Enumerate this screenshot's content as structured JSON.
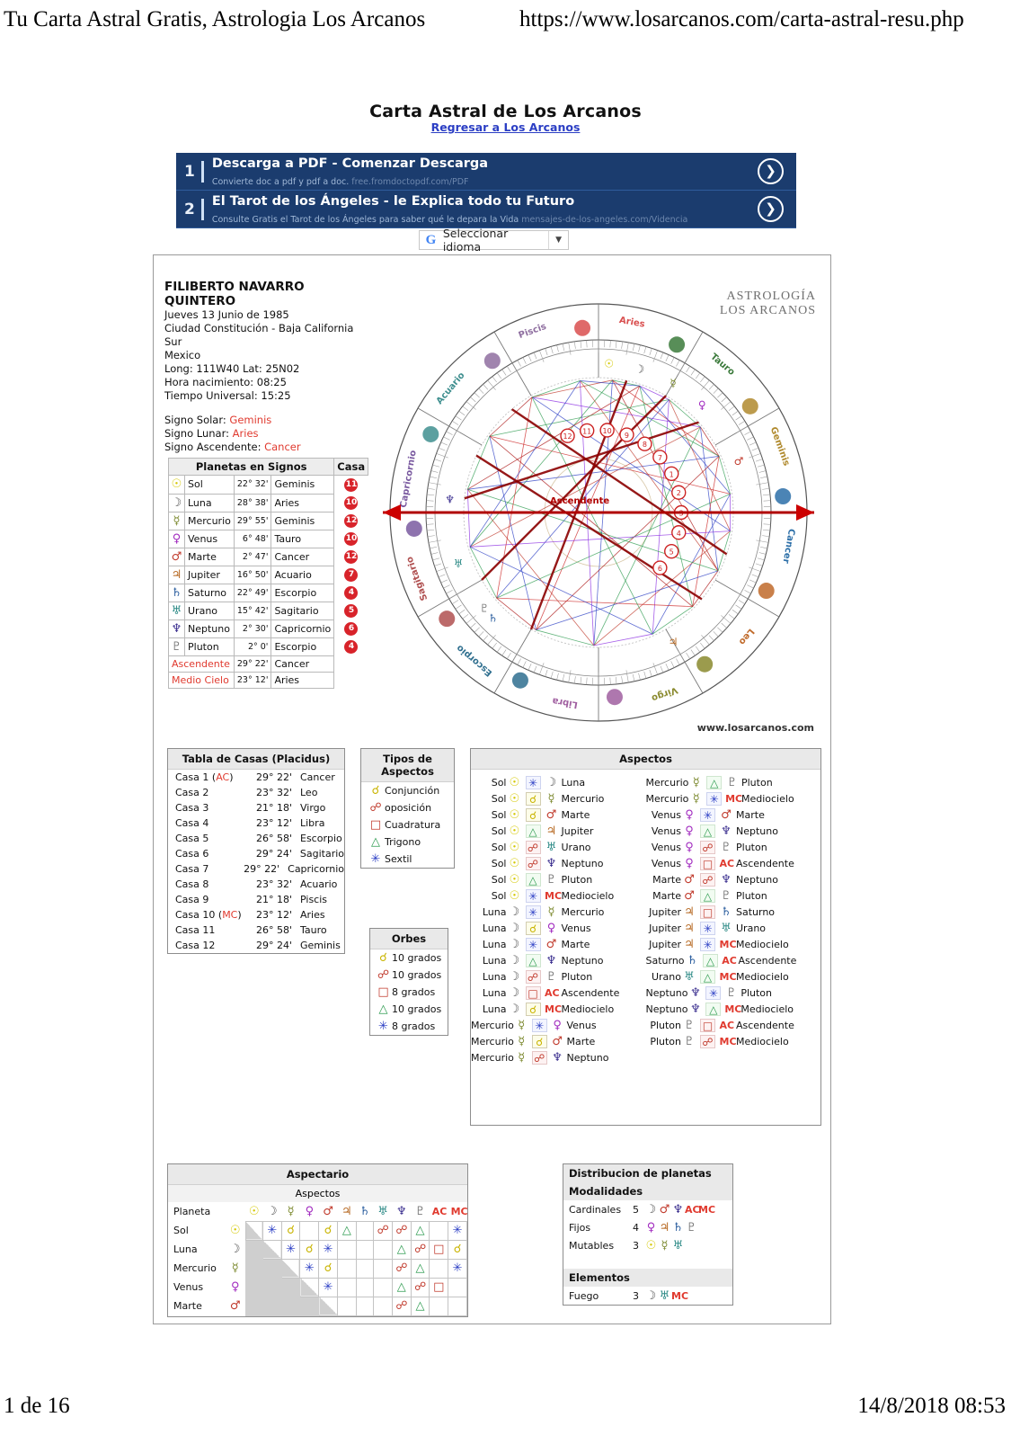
{
  "print": {
    "header_title": "Tu Carta Astral Gratis, Astrologia Los Arcanos",
    "header_url": "https://www.losarcanos.com/carta-astral-resu.php",
    "footer_page": "1 de 16",
    "footer_date": "14/8/2018 08:53"
  },
  "page": {
    "title": "Carta Astral de Los Arcanos",
    "back_link": "Regresar a Los Arcanos"
  },
  "ads": [
    {
      "num": "1",
      "headline": "Descarga a PDF - Comenzar Descarga",
      "desc": "Convierte doc a pdf y pdf a doc.",
      "url": "free.fromdoctopdf.com/PDF"
    },
    {
      "num": "2",
      "headline": "El Tarot de los Ángeles - le Explica todo tu Futuro",
      "desc": "Consulte Gratis el Tarot de los Ángeles para saber qué le depara la Vida",
      "url": "mensajes-de-los-angeles.com/Videncia"
    }
  ],
  "language": {
    "label": "Seleccionar idioma",
    "icon": "google-g-icon"
  },
  "person": {
    "name_line1": "FILIBERTO NAVARRO",
    "name_line2": "QUINTERO",
    "date": "Jueves 13 Junio de 1985",
    "city": "Ciudad Constitución - Baja California Sur",
    "country": "Mexico",
    "coords": "Long: 111W40 Lat: 25N02",
    "birth_time": "Hora nacimiento: 08:25",
    "universal_time": "Tiempo Universal: 15:25",
    "solar_label": "Signo Solar: ",
    "solar_value": "Geminis",
    "lunar_label": "Signo Lunar: ",
    "lunar_value": "Aries",
    "asc_label": "Signo Ascendente: ",
    "asc_value": "Cancer"
  },
  "planets_table": {
    "title": "Planetas en Signos",
    "house_header": "Casa",
    "rows": [
      {
        "icon": "sun-icon",
        "name": "Sol",
        "deg": "22° 32'",
        "sign": "Geminis",
        "house": "11"
      },
      {
        "icon": "moon-icon",
        "name": "Luna",
        "deg": "28° 38'",
        "sign": "Aries",
        "house": "10"
      },
      {
        "icon": "mercury-icon",
        "name": "Mercurio",
        "deg": "29° 55'",
        "sign": "Geminis",
        "house": "12"
      },
      {
        "icon": "venus-icon",
        "name": "Venus",
        "deg": "6° 48'",
        "sign": "Tauro",
        "house": "10"
      },
      {
        "icon": "mars-icon",
        "name": "Marte",
        "deg": "2° 47'",
        "sign": "Cancer",
        "house": "12"
      },
      {
        "icon": "jupiter-icon",
        "name": "Jupiter",
        "deg": "16° 50'",
        "sign": "Acuario",
        "house": "7"
      },
      {
        "icon": "saturn-icon",
        "name": "Saturno",
        "deg": "22° 49'",
        "sign": "Escorpio",
        "house": "4"
      },
      {
        "icon": "uranus-icon",
        "name": "Urano",
        "deg": "15° 42'",
        "sign": "Sagitario",
        "house": "5"
      },
      {
        "icon": "neptune-icon",
        "name": "Neptuno",
        "deg": "2° 30'",
        "sign": "Capricornio",
        "house": "6"
      },
      {
        "icon": "pluto-icon",
        "name": "Pluton",
        "deg": "2° 0'",
        "sign": "Escorpio",
        "house": "4"
      }
    ],
    "extra_rows": [
      {
        "name": "Ascendente",
        "deg": "29° 22'",
        "sign": "Cancer"
      },
      {
        "name": "Medio Cielo",
        "deg": "23° 12'",
        "sign": "Aries"
      }
    ]
  },
  "houses_table": {
    "title": "Tabla de Casas (Placidus)",
    "rows": [
      {
        "name": "Casa 1",
        "tag": "AC",
        "deg": "29° 22'",
        "sign": "Cancer"
      },
      {
        "name": "Casa 2",
        "tag": "",
        "deg": "23° 32'",
        "sign": "Leo"
      },
      {
        "name": "Casa 3",
        "tag": "",
        "deg": "21° 18'",
        "sign": "Virgo"
      },
      {
        "name": "Casa 4",
        "tag": "",
        "deg": "23° 12'",
        "sign": "Libra"
      },
      {
        "name": "Casa 5",
        "tag": "",
        "deg": "26° 58'",
        "sign": "Escorpio"
      },
      {
        "name": "Casa 6",
        "tag": "",
        "deg": "29° 24'",
        "sign": "Sagitario"
      },
      {
        "name": "Casa 7",
        "tag": "",
        "deg": "29° 22'",
        "sign": "Capricornio"
      },
      {
        "name": "Casa 8",
        "tag": "",
        "deg": "23° 32'",
        "sign": "Acuario"
      },
      {
        "name": "Casa 9",
        "tag": "",
        "deg": "21° 18'",
        "sign": "Piscis"
      },
      {
        "name": "Casa 10",
        "tag": "MC",
        "deg": "23° 12'",
        "sign": "Aries"
      },
      {
        "name": "Casa 11",
        "tag": "",
        "deg": "26° 58'",
        "sign": "Tauro"
      },
      {
        "name": "Casa 12",
        "tag": "",
        "deg": "29° 24'",
        "sign": "Geminis"
      }
    ]
  },
  "aspect_types": {
    "title_line1": "Tipos de",
    "title_line2": "Aspectos",
    "rows": [
      {
        "icon": "conjunction-icon",
        "label": "Conjunción"
      },
      {
        "icon": "opposition-icon",
        "label": "oposición"
      },
      {
        "icon": "square-icon",
        "label": "Cuadratura"
      },
      {
        "icon": "trine-icon",
        "label": "Trigono"
      },
      {
        "icon": "sextile-icon",
        "label": "Sextil"
      }
    ]
  },
  "orbs": {
    "title": "Orbes",
    "rows": [
      {
        "icon": "conjunction-icon",
        "label": "10 grados"
      },
      {
        "icon": "opposition-icon",
        "label": "10 grados"
      },
      {
        "icon": "square-icon",
        "label": "8 grados"
      },
      {
        "icon": "trine-icon",
        "label": "10 grados"
      },
      {
        "icon": "sextile-icon",
        "label": "8 grados"
      }
    ]
  },
  "aspects": {
    "title": "Aspectos",
    "left": [
      {
        "p1": "Sol",
        "i1": "sun-icon",
        "asp": "sextile-icon",
        "p2": "Luna",
        "i2": "moon-icon"
      },
      {
        "p1": "Sol",
        "i1": "sun-icon",
        "asp": "conjunction-icon",
        "p2": "Mercurio",
        "i2": "mercury-icon"
      },
      {
        "p1": "Sol",
        "i1": "sun-icon",
        "asp": "conjunction-icon",
        "p2": "Marte",
        "i2": "mars-icon"
      },
      {
        "p1": "Sol",
        "i1": "sun-icon",
        "asp": "trine-icon",
        "p2": "Jupiter",
        "i2": "jupiter-icon"
      },
      {
        "p1": "Sol",
        "i1": "sun-icon",
        "asp": "opposition-icon",
        "p2": "Urano",
        "i2": "uranus-icon"
      },
      {
        "p1": "Sol",
        "i1": "sun-icon",
        "asp": "opposition-icon",
        "p2": "Neptuno",
        "i2": "neptune-icon"
      },
      {
        "p1": "Sol",
        "i1": "sun-icon",
        "asp": "trine-icon",
        "p2": "Pluton",
        "i2": "pluto-icon"
      },
      {
        "p1": "Sol",
        "i1": "sun-icon",
        "asp": "sextile-icon",
        "p2": "Mediocielo",
        "i2": "mc-icon"
      },
      {
        "p1": "Luna",
        "i1": "moon-icon",
        "asp": "sextile-icon",
        "p2": "Mercurio",
        "i2": "mercury-icon"
      },
      {
        "p1": "Luna",
        "i1": "moon-icon",
        "asp": "conjunction-icon",
        "p2": "Venus",
        "i2": "venus-icon"
      },
      {
        "p1": "Luna",
        "i1": "moon-icon",
        "asp": "sextile-icon",
        "p2": "Marte",
        "i2": "mars-icon"
      },
      {
        "p1": "Luna",
        "i1": "moon-icon",
        "asp": "trine-icon",
        "p2": "Neptuno",
        "i2": "neptune-icon"
      },
      {
        "p1": "Luna",
        "i1": "moon-icon",
        "asp": "opposition-icon",
        "p2": "Pluton",
        "i2": "pluto-icon"
      },
      {
        "p1": "Luna",
        "i1": "moon-icon",
        "asp": "square-icon",
        "p2": "Ascendente",
        "i2": "ac-icon"
      },
      {
        "p1": "Luna",
        "i1": "moon-icon",
        "asp": "conjunction-icon",
        "p2": "Mediocielo",
        "i2": "mc-icon"
      },
      {
        "p1": "Mercurio",
        "i1": "mercury-icon",
        "asp": "sextile-icon",
        "p2": "Venus",
        "i2": "venus-icon"
      },
      {
        "p1": "Mercurio",
        "i1": "mercury-icon",
        "asp": "conjunction-icon",
        "p2": "Marte",
        "i2": "mars-icon"
      },
      {
        "p1": "Mercurio",
        "i1": "mercury-icon",
        "asp": "opposition-icon",
        "p2": "Neptuno",
        "i2": "neptune-icon"
      }
    ],
    "right": [
      {
        "p1": "Mercurio",
        "i1": "mercury-icon",
        "asp": "trine-icon",
        "p2": "Pluton",
        "i2": "pluto-icon"
      },
      {
        "p1": "Mercurio",
        "i1": "mercury-icon",
        "asp": "sextile-icon",
        "p2": "Mediocielo",
        "i2": "mc-icon"
      },
      {
        "p1": "Venus",
        "i1": "venus-icon",
        "asp": "sextile-icon",
        "p2": "Marte",
        "i2": "mars-icon"
      },
      {
        "p1": "Venus",
        "i1": "venus-icon",
        "asp": "trine-icon",
        "p2": "Neptuno",
        "i2": "neptune-icon"
      },
      {
        "p1": "Venus",
        "i1": "venus-icon",
        "asp": "opposition-icon",
        "p2": "Pluton",
        "i2": "pluto-icon"
      },
      {
        "p1": "Venus",
        "i1": "venus-icon",
        "asp": "square-icon",
        "p2": "Ascendente",
        "i2": "ac-icon"
      },
      {
        "p1": "Marte",
        "i1": "mars-icon",
        "asp": "opposition-icon",
        "p2": "Neptuno",
        "i2": "neptune-icon"
      },
      {
        "p1": "Marte",
        "i1": "mars-icon",
        "asp": "trine-icon",
        "p2": "Pluton",
        "i2": "pluto-icon"
      },
      {
        "p1": "Jupiter",
        "i1": "jupiter-icon",
        "asp": "square-icon",
        "p2": "Saturno",
        "i2": "saturn-icon"
      },
      {
        "p1": "Jupiter",
        "i1": "jupiter-icon",
        "asp": "sextile-icon",
        "p2": "Urano",
        "i2": "uranus-icon"
      },
      {
        "p1": "Jupiter",
        "i1": "jupiter-icon",
        "asp": "sextile-icon",
        "p2": "Mediocielo",
        "i2": "mc-icon"
      },
      {
        "p1": "Saturno",
        "i1": "saturn-icon",
        "asp": "trine-icon",
        "p2": "Ascendente",
        "i2": "ac-icon"
      },
      {
        "p1": "Urano",
        "i1": "uranus-icon",
        "asp": "trine-icon",
        "p2": "Mediocielo",
        "i2": "mc-icon"
      },
      {
        "p1": "Neptuno",
        "i1": "neptune-icon",
        "asp": "sextile-icon",
        "p2": "Pluton",
        "i2": "pluto-icon"
      },
      {
        "p1": "Neptuno",
        "i1": "neptune-icon",
        "asp": "trine-icon",
        "p2": "Mediocielo",
        "i2": "mc-icon"
      },
      {
        "p1": "Pluton",
        "i1": "pluto-icon",
        "asp": "square-icon",
        "p2": "Ascendente",
        "i2": "ac-icon"
      },
      {
        "p1": "Pluton",
        "i1": "pluto-icon",
        "asp": "opposition-icon",
        "p2": "Mediocielo",
        "i2": "mc-icon"
      }
    ]
  },
  "aspectario": {
    "title": "Aspectario",
    "sub": "Aspectos",
    "planeta_label": "Planeta",
    "col_icons": [
      "sun-icon",
      "moon-icon",
      "mercury-icon",
      "venus-icon",
      "mars-icon",
      "jupiter-icon",
      "saturn-icon",
      "uranus-icon",
      "neptune-icon",
      "pluto-icon",
      "ac-icon",
      "mc-icon"
    ],
    "rows": [
      {
        "name": "Sol",
        "icon": "sun-icon",
        "cells": [
          "blank",
          "sextile-icon",
          "conjunction-icon",
          "",
          "conjunction-icon",
          "trine-icon",
          "",
          "opposition-icon",
          "opposition-icon",
          "trine-icon",
          "",
          "sextile-icon"
        ]
      },
      {
        "name": "Luna",
        "icon": "moon-icon",
        "cells": [
          "blank",
          "blank",
          "sextile-icon",
          "conjunction-icon",
          "sextile-icon",
          "",
          "",
          "",
          "trine-icon",
          "opposition-icon",
          "square-icon",
          "conjunction-icon"
        ]
      },
      {
        "name": "Mercurio",
        "icon": "mercury-icon",
        "cells": [
          "blank",
          "blank",
          "blank",
          "sextile-icon",
          "conjunction-icon",
          "",
          "",
          "",
          "opposition-icon",
          "trine-icon",
          "",
          "sextile-icon"
        ]
      },
      {
        "name": "Venus",
        "icon": "venus-icon",
        "cells": [
          "blank",
          "blank",
          "blank",
          "blank",
          "sextile-icon",
          "",
          "",
          "",
          "trine-icon",
          "opposition-icon",
          "square-icon",
          ""
        ]
      },
      {
        "name": "Marte",
        "icon": "mars-icon",
        "cells": [
          "blank",
          "blank",
          "blank",
          "blank",
          "blank",
          "",
          "",
          "",
          "opposition-icon",
          "trine-icon",
          "",
          ""
        ]
      }
    ]
  },
  "distribution": {
    "title": "Distribucion de planetas",
    "modalities_title": "Modalidades",
    "modalities": [
      {
        "name": "Cardinales",
        "count": "5",
        "icons": [
          "moon-icon",
          "mars-icon",
          "neptune-icon",
          "ac-icon",
          "mc-icon"
        ]
      },
      {
        "name": "Fijos",
        "count": "4",
        "icons": [
          "venus-icon",
          "jupiter-icon",
          "saturn-icon",
          "pluto-icon"
        ]
      },
      {
        "name": "Mutables",
        "count": "3",
        "icons": [
          "sun-icon",
          "mercury-icon",
          "uranus-icon"
        ]
      }
    ],
    "elements_title": "Elementos",
    "elements": [
      {
        "name": "Fuego",
        "count": "3",
        "icons": [
          "moon-icon",
          "uranus-icon",
          "mc-icon"
        ]
      }
    ]
  },
  "wheel": {
    "brand_line1": "ASTROLOGÍA",
    "brand_line2": "LOS ARCANOS",
    "website": "www.losarcanos.com",
    "ascendente_label": "Ascendente",
    "signs": [
      "Aries",
      "Tauro",
      "Geminis",
      "Cancer",
      "Leo",
      "Virgo",
      "Libra",
      "Escorpio",
      "Sagitario",
      "Capricornio",
      "Acuario",
      "Piscis"
    ]
  }
}
